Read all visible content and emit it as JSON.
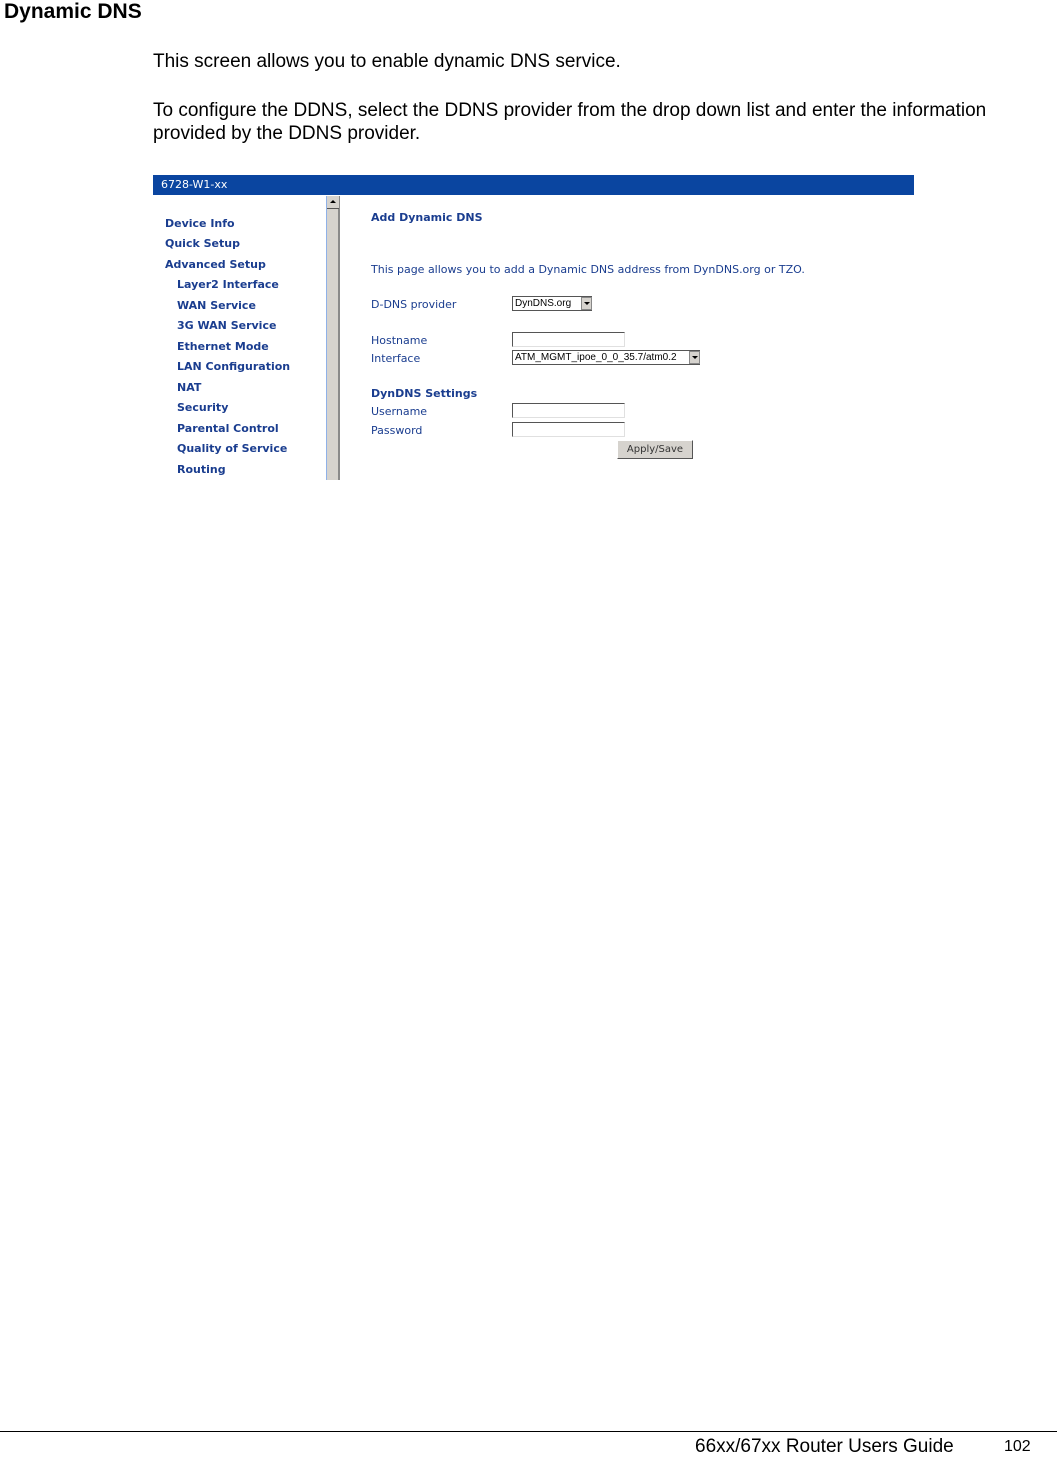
{
  "document": {
    "heading": "Dynamic DNS",
    "paragraphs": [
      "This screen allows you to enable dynamic DNS service.",
      "To configure the DDNS, select the DDNS provider from the drop down list and enter the information provided by the DDNS provider."
    ],
    "footer": {
      "title": "66xx/67xx Router Users Guide",
      "page_number": "102"
    }
  },
  "screenshot": {
    "window_title": "6728-W1-xx",
    "title_bar_color": "#0a45a0",
    "nav": {
      "items": [
        {
          "label": "Device Info",
          "level": 0
        },
        {
          "label": "Quick Setup",
          "level": 0
        },
        {
          "label": "Advanced Setup",
          "level": 0
        },
        {
          "label": "Layer2 Interface",
          "level": 1
        },
        {
          "label": "WAN Service",
          "level": 1
        },
        {
          "label": "3G WAN Service",
          "level": 1
        },
        {
          "label": "Ethernet Mode",
          "level": 1
        },
        {
          "label": "LAN Configuration",
          "level": 1
        },
        {
          "label": "NAT",
          "level": 1
        },
        {
          "label": "Security",
          "level": 1
        },
        {
          "label": "Parental Control",
          "level": 1
        },
        {
          "label": "Quality of Service",
          "level": 1
        },
        {
          "label": "Routing",
          "level": 1
        }
      ]
    },
    "form": {
      "title": "Add Dynamic DNS",
      "description": "This page allows you to add a Dynamic DNS address from DynDNS.org or TZO.",
      "provider_label": "D-DNS provider",
      "provider_value": "DynDNS.org",
      "hostname_label": "Hostname",
      "hostname_value": "",
      "interface_label": "Interface",
      "interface_value": "ATM_MGMT_ipoe_0_0_35.7/atm0.2",
      "settings_heading": "DynDNS Settings",
      "username_label": "Username",
      "username_value": "",
      "password_label": "Password",
      "password_value": "",
      "apply_button": "Apply/Save"
    }
  }
}
